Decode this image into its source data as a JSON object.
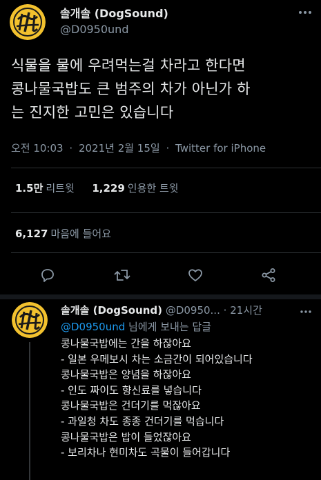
{
  "colors": {
    "background": "#000000",
    "text_primary": "#e7e9ea",
    "text_secondary": "#8b98a5",
    "link": "#1d9bf0",
    "avatar_yellow": "#f2c12e"
  },
  "tweet": {
    "display_name": "솔개솔 (DogSound)",
    "handle": "@D0950und",
    "avatar_icon": "avatar-image",
    "text_lines": [
      "식물을 물에 우려먹는걸 차라고 한다면",
      "콩나물국밥도 큰 범주의 차가 아닌가 하",
      "는 진지한 고민은 있습니다"
    ],
    "time": "오전 10:03",
    "date": "2021년 2월 15일",
    "dot": "·",
    "source": "Twitter for iPhone",
    "retweets": {
      "count": "1.5만",
      "label": "리트윗"
    },
    "quotes": {
      "count": "1,229",
      "label": "인용한 트윗"
    },
    "likes": {
      "count": "6,127",
      "label": "마음에 들어요"
    },
    "actions": [
      {
        "name": "reply-icon"
      },
      {
        "name": "retweet-icon"
      },
      {
        "name": "like-icon"
      },
      {
        "name": "share-icon"
      }
    ]
  },
  "reply": {
    "display_name": "솔개솔 (DogSound)",
    "handle": "@D0950...",
    "dot": "·",
    "time": "21시간",
    "replying_mention": "@D0950und",
    "replying_suffix": " 님에게 보내는 답글",
    "text_lines": [
      "콩나물국밥에는 간을 하잖아요",
      "- 일본 우메보시 차는 소금간이 되어있습니다",
      "콩나물국밥은 양념을 하잖아요",
      "- 인도 짜이도 향신료를 넣습니다",
      "콩나물국밥은 건더기를 먹잖아요",
      "- 과일청 차도 종종 건더기를 먹습니다",
      "콩나물국밥은 밥이 들었잖아요",
      "- 보리차나 현미차도 곡물이 들어갑니다"
    ]
  }
}
